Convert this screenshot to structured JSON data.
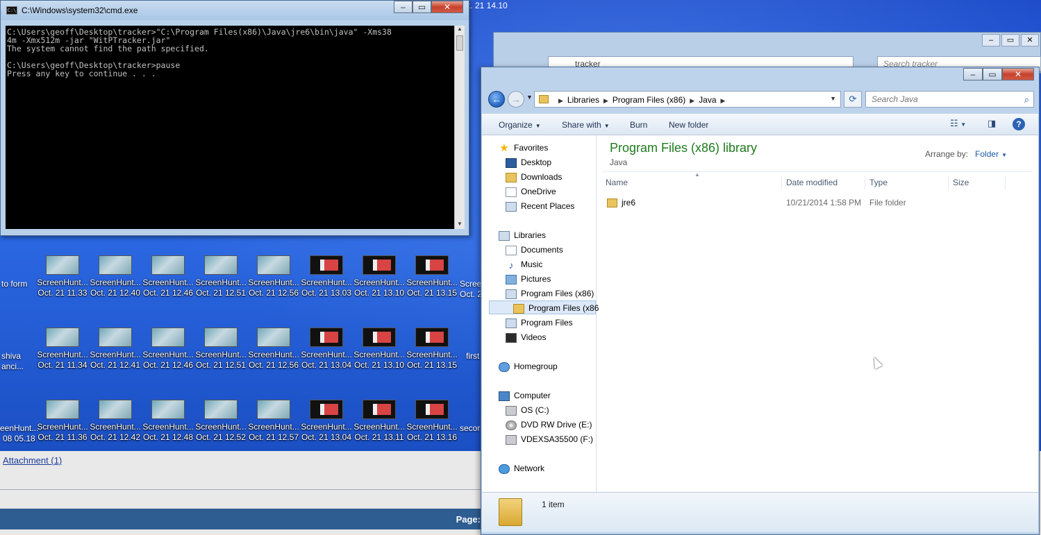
{
  "cmd": {
    "title": "C:\\Windows\\system32\\cmd.exe",
    "icon_text": "C:\\",
    "lines": [
      "C:\\Users\\geoff\\Desktop\\tracker>\"C:\\Program Files(x86)\\Java\\jre6\\bin\\java\" -Xms38",
      "4m -Xmx512m -jar \"WitPTracker.jar\"",
      "The system cannot find the path specified.",
      "",
      "C:\\Users\\geoff\\Desktop\\tracker>pause",
      "Press any key to continue . . ."
    ]
  },
  "window_controls": {
    "minimize": "–",
    "maximize": "▭",
    "close": "✕"
  },
  "background_window": {
    "address": "tracker",
    "search_placeholder": "Search tracker",
    "clock_fragment": "t. 21 14.10"
  },
  "explorer": {
    "breadcrumbs": [
      "Libraries",
      "Program Files (x86)",
      "Java"
    ],
    "search_placeholder": "Search Java",
    "toolbar": {
      "organize": "Organize",
      "share_with": "Share with",
      "burn": "Burn",
      "new_folder": "New folder"
    },
    "nav": {
      "favorites": "Favorites",
      "desktop": "Desktop",
      "downloads": "Downloads",
      "onedrive": "OneDrive",
      "recent_places": "Recent Places",
      "libraries": "Libraries",
      "documents": "Documents",
      "music": "Music",
      "pictures": "Pictures",
      "program_files_x86": "Program Files (x86)",
      "program_files_x86_sub": "Program Files (x86",
      "program_files": "Program Files",
      "videos": "Videos",
      "homegroup": "Homegroup",
      "computer": "Computer",
      "os_c": "OS (C:)",
      "dvd": "DVD RW Drive (E:)",
      "vdex": "VDEXSA35500 (F:)",
      "network": "Network"
    },
    "library_title": "Program Files (x86) library",
    "library_subtitle": "Java",
    "arrange_by_label": "Arrange by:",
    "arrange_by_value": "Folder",
    "columns": {
      "name": "Name",
      "date": "Date modified",
      "type": "Type",
      "size": "Size"
    },
    "rows": [
      {
        "name": "jre6",
        "date": "10/21/2014 1:58 PM",
        "type": "File folder",
        "size": ""
      }
    ],
    "status_count": "1 item"
  },
  "desktop": {
    "icons": [
      {
        "l1": "ScreenHunt...",
        "l2": "Oct. 21 11.33",
        "thumb": "teal"
      },
      {
        "l1": "ScreenHunt...",
        "l2": "Oct. 21 12.40",
        "thumb": "teal"
      },
      {
        "l1": "ScreenHunt...",
        "l2": "Oct. 21 12.46",
        "thumb": "teal"
      },
      {
        "l1": "ScreenHunt...",
        "l2": "Oct. 21 12.51",
        "thumb": "teal"
      },
      {
        "l1": "ScreenHunt...",
        "l2": "Oct. 21 12.56",
        "thumb": "teal"
      },
      {
        "l1": "ScreenHunt...",
        "l2": "Oct. 21 13.03",
        "thumb": "dark"
      },
      {
        "l1": "ScreenHunt...",
        "l2": "Oct. 21 13.10",
        "thumb": "dark"
      },
      {
        "l1": "ScreenHunt...",
        "l2": "Oct. 21 13.15",
        "thumb": "dark"
      },
      {
        "l1": "ScreenHunt...",
        "l2": "Oct. 21 11.34",
        "thumb": "teal"
      },
      {
        "l1": "ScreenHunt...",
        "l2": "Oct. 21 12.41",
        "thumb": "teal"
      },
      {
        "l1": "ScreenHunt...",
        "l2": "Oct. 21 12.46",
        "thumb": "teal"
      },
      {
        "l1": "ScreenHunt...",
        "l2": "Oct. 21 12.51",
        "thumb": "teal"
      },
      {
        "l1": "ScreenHunt...",
        "l2": "Oct. 21 12.56",
        "thumb": "teal"
      },
      {
        "l1": "ScreenHunt...",
        "l2": "Oct. 21 13.04",
        "thumb": "dark"
      },
      {
        "l1": "ScreenHunt...",
        "l2": "Oct. 21 13.10",
        "thumb": "dark"
      },
      {
        "l1": "ScreenHunt...",
        "l2": "Oct. 21 13.15",
        "thumb": "dark"
      },
      {
        "l1": "ScreenHunt...",
        "l2": "Oct. 21 11.36",
        "thumb": "teal"
      },
      {
        "l1": "ScreenHunt...",
        "l2": "Oct. 21 12.42",
        "thumb": "teal"
      },
      {
        "l1": "ScreenHunt...",
        "l2": "Oct. 21 12.48",
        "thumb": "teal"
      },
      {
        "l1": "ScreenHunt...",
        "l2": "Oct. 21 12.52",
        "thumb": "teal"
      },
      {
        "l1": "ScreenHunt...",
        "l2": "Oct. 21 12.57",
        "thumb": "teal"
      },
      {
        "l1": "ScreenHunt...",
        "l2": "Oct. 21 13.04",
        "thumb": "dark"
      },
      {
        "l1": "ScreenHunt...",
        "l2": "Oct. 21 13.11",
        "thumb": "dark"
      },
      {
        "l1": "ScreenHunt...",
        "l2": "Oct. 21 13.16",
        "thumb": "dark"
      }
    ],
    "partial": {
      "r1_left": "to form",
      "r1_right_l1": "Scree",
      "r1_right_l2": "Oct. 2",
      "r2_left_l1": "shiva",
      "r2_left_l2": "anci...",
      "r2_right": "first",
      "r3_left_l1": "eenHunt...",
      "r3_left_l2": "08 05.18",
      "r3_right": "secor"
    }
  },
  "webpage": {
    "attachment": "Attachment (1)",
    "page_label": "Page:"
  }
}
